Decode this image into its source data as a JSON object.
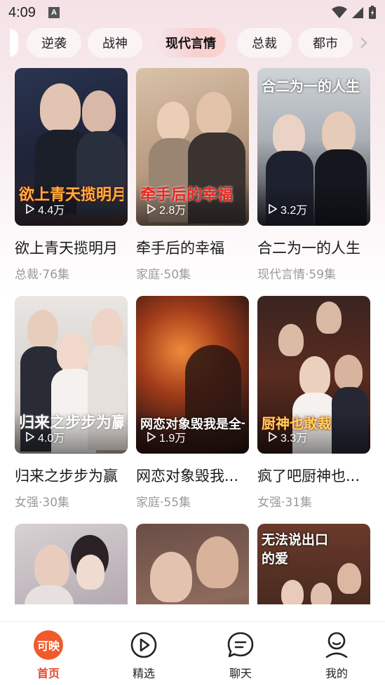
{
  "status_bar": {
    "time": "4:09",
    "notification_badge": "A"
  },
  "categories": {
    "items": [
      {
        "label": "逆袭",
        "active": false
      },
      {
        "label": "战神",
        "active": false
      },
      {
        "label": "现代言情",
        "active": true
      },
      {
        "label": "总裁",
        "active": false
      },
      {
        "label": "都市",
        "active": false
      }
    ]
  },
  "dramas": [
    {
      "title": "欲上青天揽明月",
      "meta": "总裁·76集",
      "views": "4.4万",
      "poster_text": "欲上青天揽明月"
    },
    {
      "title": "牵手后的幸福",
      "meta": "家庭·50集",
      "views": "2.8万",
      "poster_text": "牵手后的幸福"
    },
    {
      "title": "合二为一的人生",
      "meta": "现代言情·59集",
      "views": "3.2万",
      "poster_text": "合二为一的人生"
    },
    {
      "title": "归来之步步为赢",
      "meta": "女强·30集",
      "views": "4.0万",
      "poster_text": "归来之步步为赢"
    },
    {
      "title": "网恋对象毁我...",
      "meta": "家庭·55集",
      "views": "1.9万",
      "poster_text": "网恋对象毁我是全一"
    },
    {
      "title": "疯了吧厨神也...",
      "meta": "女强·31集",
      "views": "3.3万",
      "poster_text": "厨神也敢裁"
    },
    {
      "title": "",
      "meta": "",
      "views": "",
      "poster_text": ""
    },
    {
      "title": "",
      "meta": "",
      "views": "",
      "poster_text": ""
    },
    {
      "title": "",
      "meta": "",
      "views": "",
      "poster_text": "无法说出口的爱"
    }
  ],
  "bottom_nav": {
    "home_badge": "可映",
    "items": [
      {
        "label": "首页",
        "icon": "home-badge-icon",
        "active": true
      },
      {
        "label": "精选",
        "icon": "play-circle-icon",
        "active": false
      },
      {
        "label": "聊天",
        "icon": "chat-bubble-icon",
        "active": false
      },
      {
        "label": "我的",
        "icon": "user-icon",
        "active": false
      }
    ]
  },
  "colors": {
    "accent": "#f05a2a",
    "active_label": "#e8452a",
    "muted_text": "#9a9a9a"
  }
}
